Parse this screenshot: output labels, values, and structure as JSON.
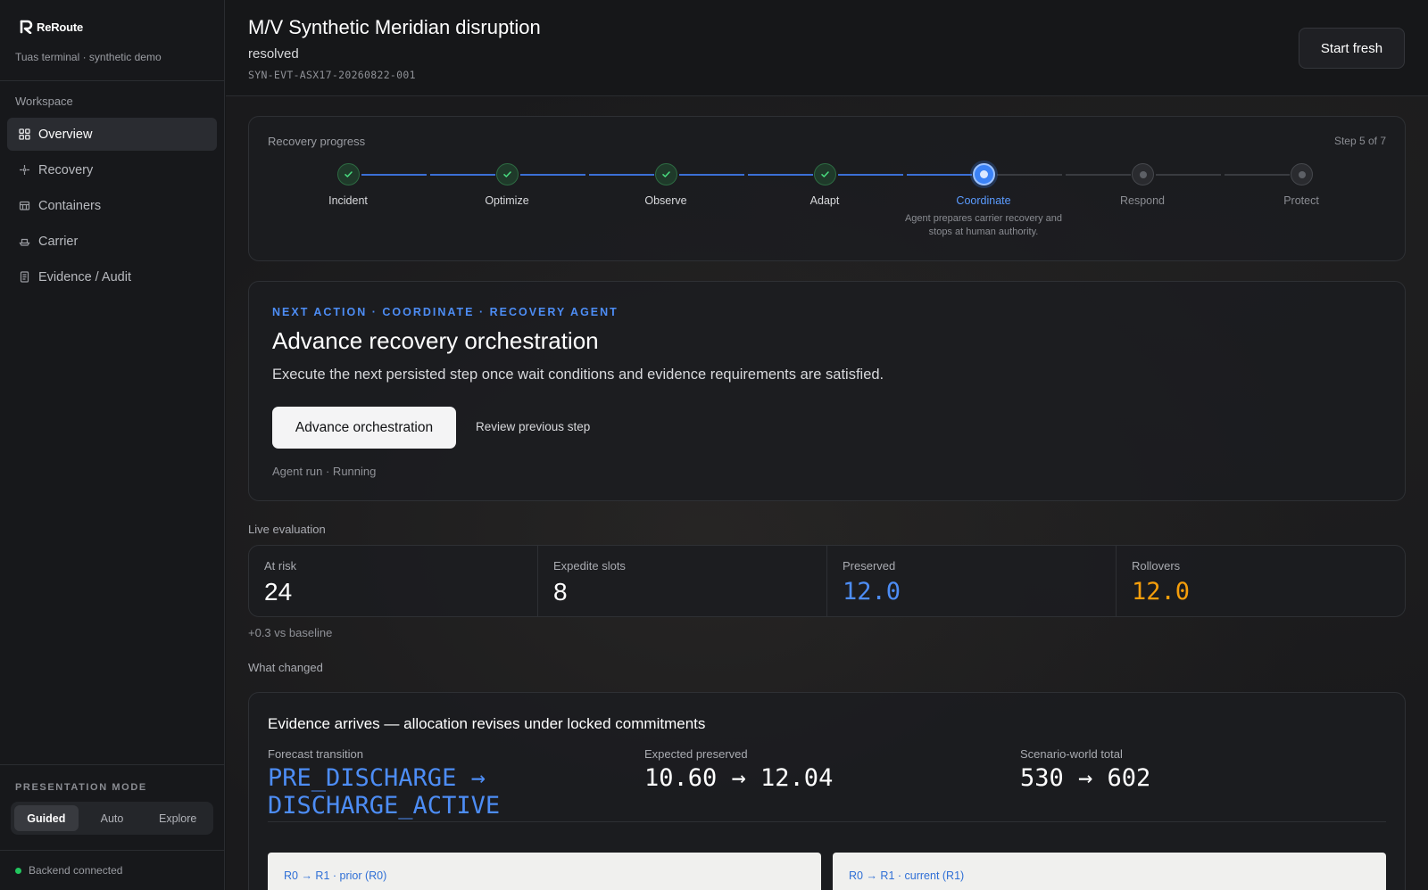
{
  "brand": {
    "name": "ReRoute",
    "subtitle": "Tuas terminal · synthetic demo"
  },
  "sidebar": {
    "section": "Workspace",
    "items": [
      {
        "label": "Overview",
        "icon": "grid-icon",
        "active": true
      },
      {
        "label": "Recovery",
        "icon": "sparkle-icon"
      },
      {
        "label": "Containers",
        "icon": "container-icon"
      },
      {
        "label": "Carrier",
        "icon": "ship-icon"
      },
      {
        "label": "Evidence / Audit",
        "icon": "document-icon"
      }
    ],
    "presentation_mode": {
      "label": "PRESENTATION MODE",
      "options": [
        "Guided",
        "Auto",
        "Explore"
      ],
      "selected": "Guided"
    },
    "backend_status": "Backend connected"
  },
  "header": {
    "title": "M/V Synthetic Meridian disruption",
    "status": "resolved",
    "event_id": "SYN-EVT-ASX17-20260822-001",
    "start_fresh": "Start fresh"
  },
  "progress": {
    "label": "Recovery progress",
    "step_counter": "Step 5 of 7",
    "steps": [
      {
        "name": "Incident",
        "state": "done"
      },
      {
        "name": "Optimize",
        "state": "done"
      },
      {
        "name": "Observe",
        "state": "done"
      },
      {
        "name": "Adapt",
        "state": "done"
      },
      {
        "name": "Coordinate",
        "state": "current",
        "desc": "Agent prepares carrier recovery and stops at human authority."
      },
      {
        "name": "Respond",
        "state": "future"
      },
      {
        "name": "Protect",
        "state": "future"
      }
    ]
  },
  "next_action": {
    "eyebrow": "NEXT ACTION · COORDINATE · RECOVERY AGENT",
    "title": "Advance recovery orchestration",
    "description": "Execute the next persisted step once wait conditions and evidence requirements are satisfied.",
    "primary": "Advance orchestration",
    "secondary": "Review previous step",
    "agent_run": "Agent run · Running"
  },
  "live_evaluation": {
    "label": "Live evaluation",
    "metrics": [
      {
        "label": "At risk",
        "value": "24"
      },
      {
        "label": "Expedite slots",
        "value": "8"
      },
      {
        "label": "Preserved",
        "value": "12.0"
      },
      {
        "label": "Rollovers",
        "value": "12.0"
      }
    ],
    "baseline": "+0.3 vs baseline"
  },
  "what_changed": {
    "label": "What changed",
    "title": "Evidence arrives — allocation revises under locked commitments",
    "forecast": {
      "label": "Forecast transition",
      "value": "PRE_DISCHARGE → DISCHARGE_ACTIVE"
    },
    "expected": {
      "label": "Expected preserved",
      "value": "10.60 → 12.04"
    },
    "total": {
      "label": "Scenario-world total",
      "value": "530 → 602"
    },
    "panels": [
      "R0 → R1 · prior (R0)",
      "R0 → R1 · current (R1)"
    ]
  },
  "colors": {
    "accent": "#3b82f6",
    "success": "#22c55e",
    "warning": "#f59e0b"
  }
}
